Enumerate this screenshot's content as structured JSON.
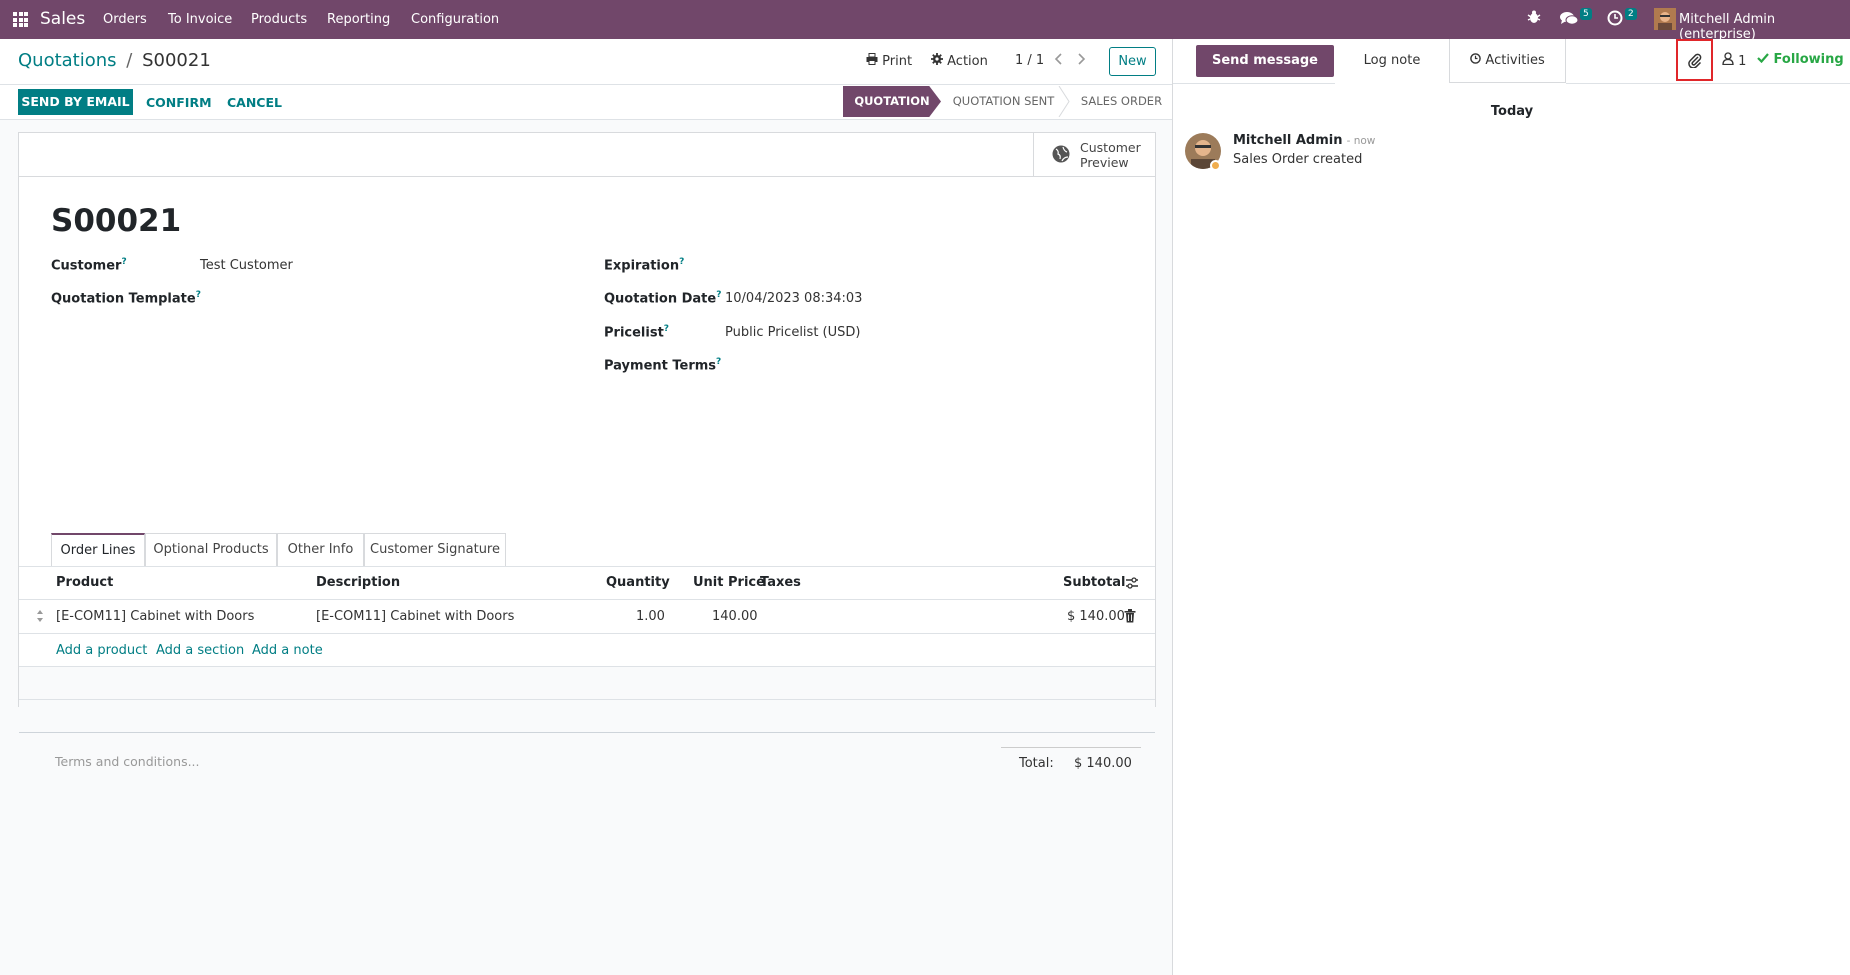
{
  "navbar": {
    "app_name": "Sales",
    "menus": [
      "Orders",
      "To Invoice",
      "Products",
      "Reporting",
      "Configuration"
    ],
    "messages_count": "5",
    "activities_count": "2",
    "user_name": "Mitchell Admin (enterprise)"
  },
  "breadcrumb": {
    "parent": "Quotations",
    "separator": "/",
    "current": "S00021"
  },
  "control": {
    "print_label": "Print",
    "action_label": "Action",
    "pager": "1 / 1",
    "new_label": "New"
  },
  "buttons": {
    "send_by_email": "SEND BY EMAIL",
    "confirm": "CONFIRM",
    "cancel": "CANCEL"
  },
  "statusbar": {
    "stages": [
      "QUOTATION",
      "QUOTATION SENT",
      "SALES ORDER"
    ],
    "active": "QUOTATION"
  },
  "sheet": {
    "customer_preview": [
      "Customer",
      "Preview"
    ],
    "title": "S00021",
    "fields": {
      "customer_label": "Customer",
      "customer_value": "Test Customer",
      "template_label": "Quotation Template",
      "expiration_label": "Expiration",
      "date_label": "Quotation Date",
      "date_value": "10/04/2023 08:34:03",
      "pricelist_label": "Pricelist",
      "pricelist_value": "Public Pricelist (USD)",
      "payment_terms_label": "Payment Terms",
      "help_mark": "?"
    },
    "tabs": [
      "Order Lines",
      "Optional Products",
      "Other Info",
      "Customer Signature"
    ],
    "table": {
      "headers": {
        "product": "Product",
        "description": "Description",
        "quantity": "Quantity",
        "unit_price": "Unit Price",
        "taxes": "Taxes",
        "subtotal": "Subtotal"
      },
      "rows": [
        {
          "product": "[E-COM11] Cabinet with Doors",
          "description": "[E-COM11] Cabinet with Doors",
          "quantity": "1.00",
          "unit_price": "140.00",
          "taxes": "",
          "subtotal": "$ 140.00"
        }
      ],
      "add_links": [
        "Add a product",
        "Add a section",
        "Add a note"
      ]
    },
    "terms_placeholder": "Terms and conditions...",
    "total_label": "Total:",
    "total_value": "$ 140.00"
  },
  "chatter": {
    "send_message": "Send message",
    "log_note": "Log note",
    "activities": "Activities",
    "followers_count": "1",
    "following": "Following",
    "date_separator": "Today",
    "messages": [
      {
        "author": "Mitchell Admin",
        "time": "- now",
        "body": "Sales Order created"
      }
    ]
  },
  "colors": {
    "brand": "#71476a",
    "accent": "#017e84",
    "highlight_box": "#e0262a",
    "following": "#28a745"
  }
}
